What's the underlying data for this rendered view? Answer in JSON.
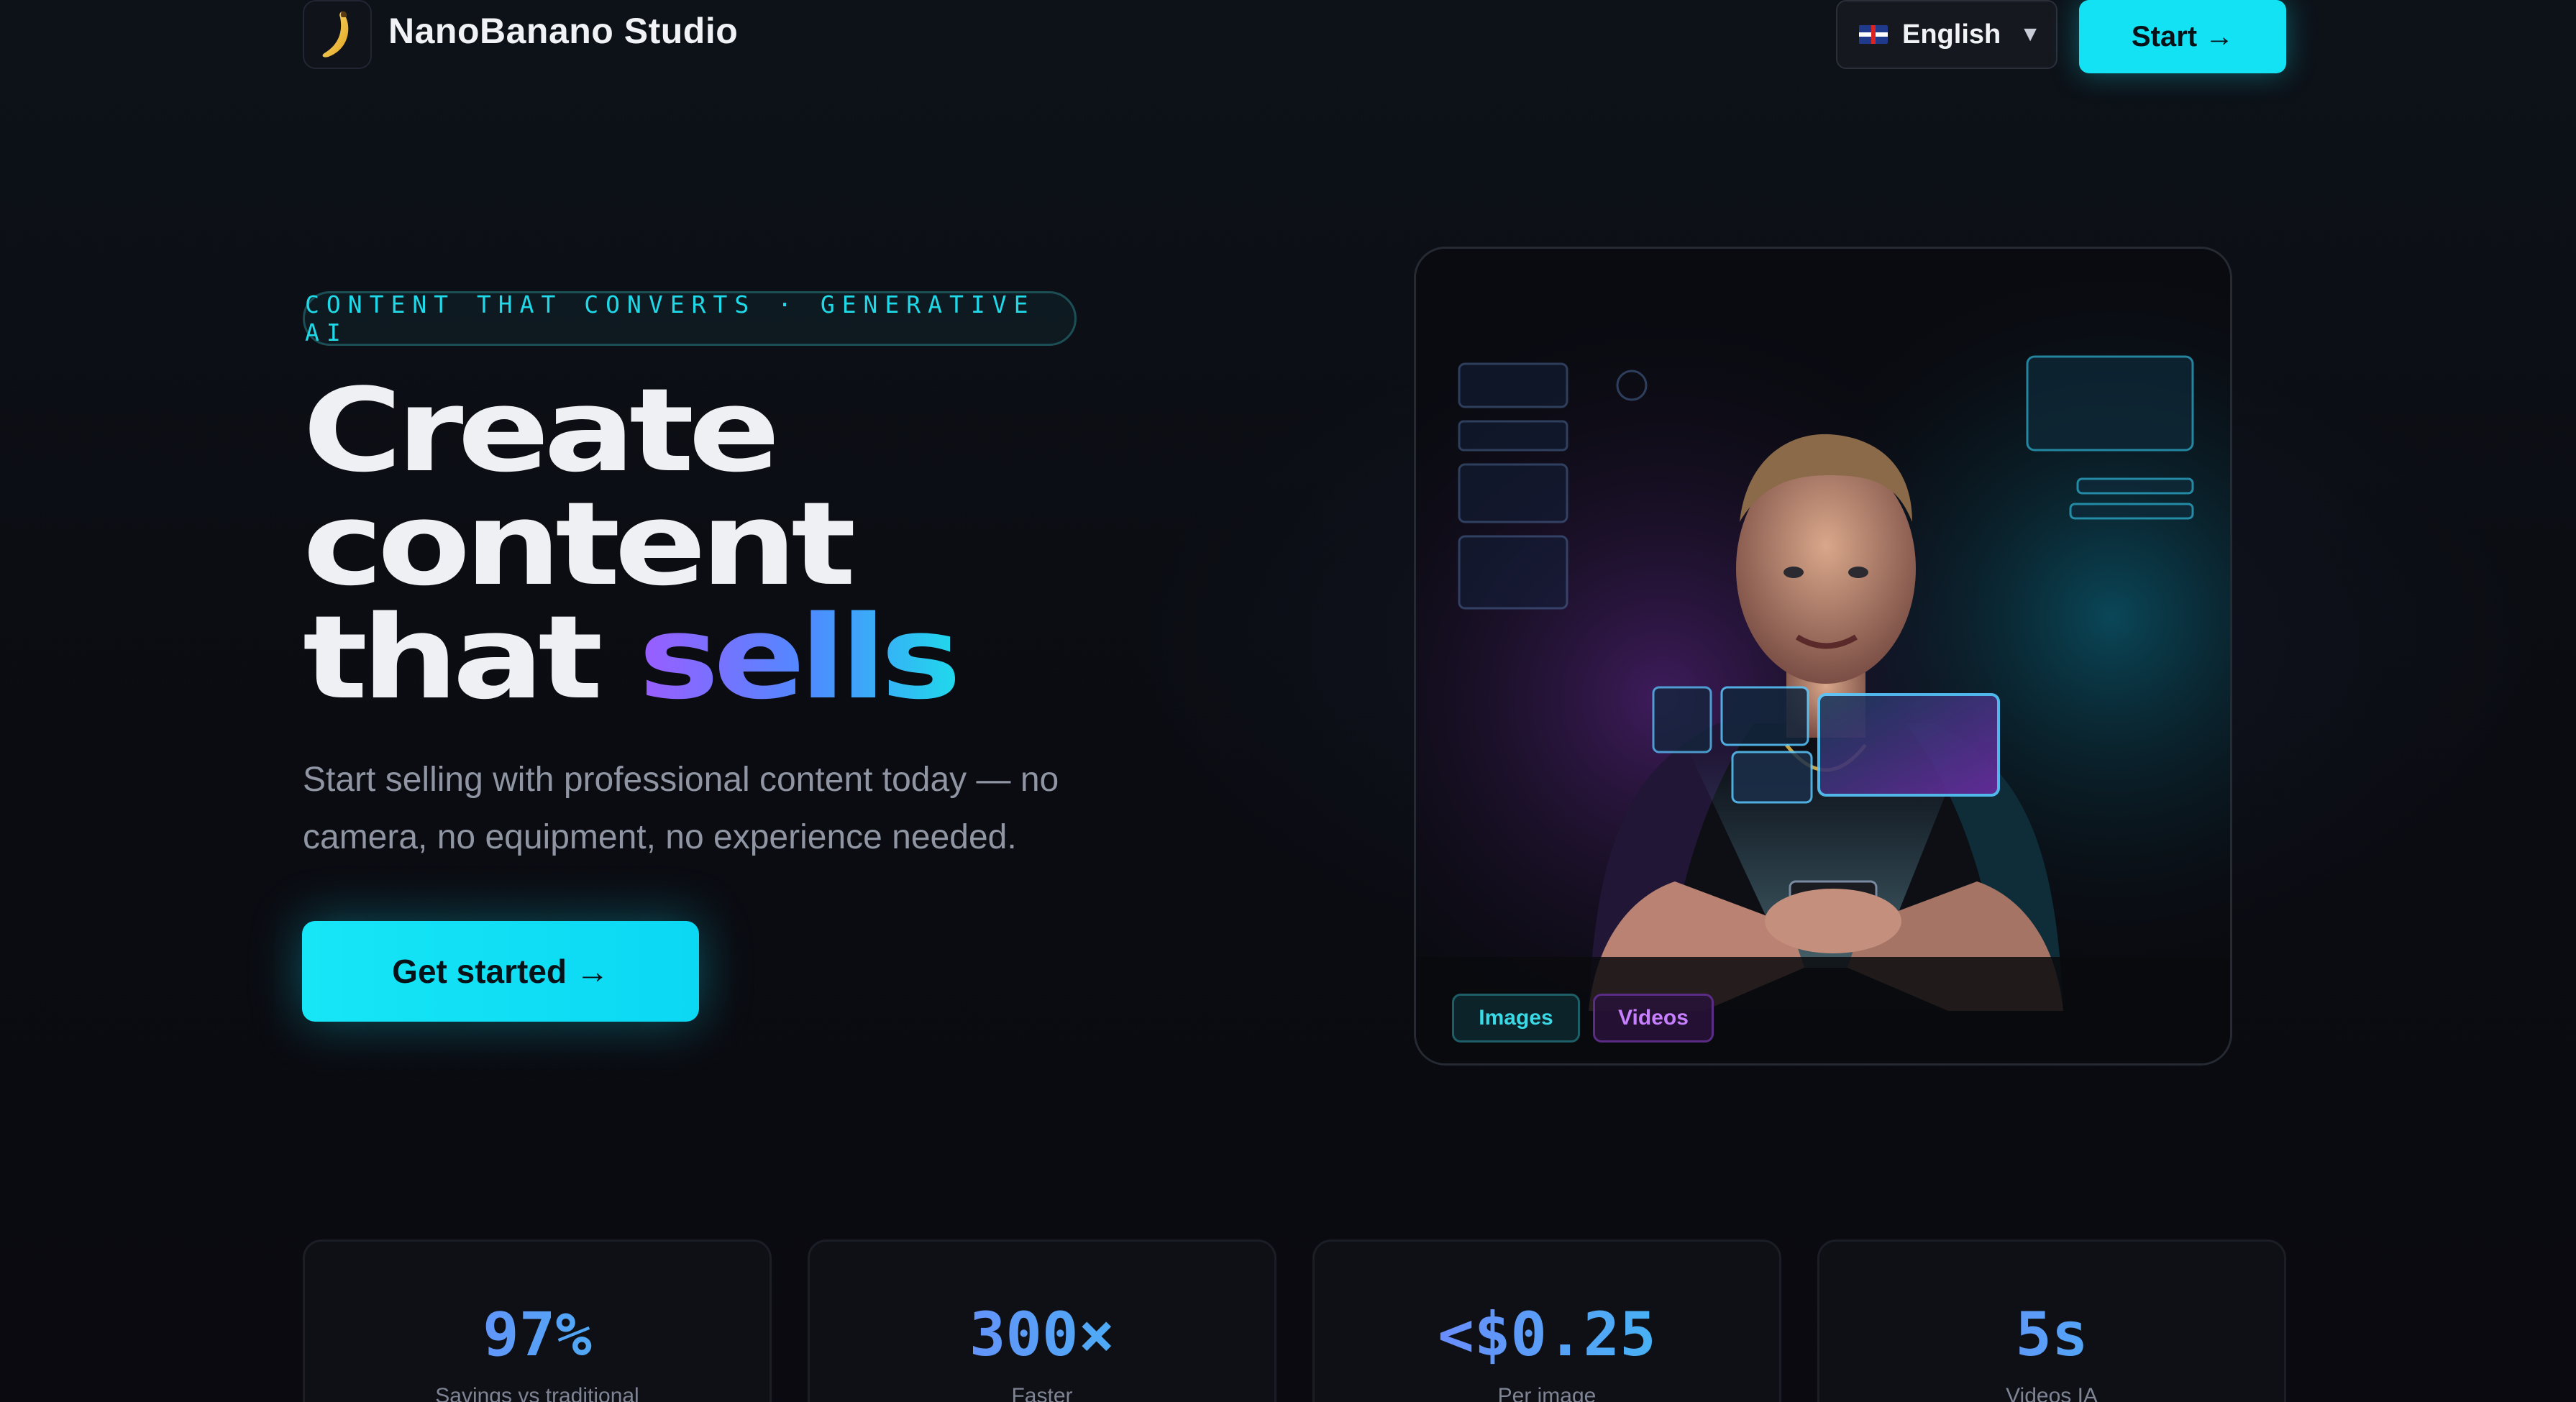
{
  "header": {
    "brand": "NanoBanano Studio",
    "logo_icon": "banana-icon",
    "language": "English",
    "start_label": "Start →"
  },
  "hero": {
    "eyebrow": "CONTENT THAT CONVERTS · GENERATIVE AI",
    "headline_line1": "Create",
    "headline_line2": "content",
    "headline_line3_plain": "that",
    "headline_line3_highlight": "sells",
    "subtitle": "Start selling with professional content today — no camera, no equipment, no experience needed.",
    "cta_label": "Get started →"
  },
  "media_card": {
    "tags": [
      "Images",
      "Videos"
    ]
  },
  "stats": [
    {
      "value": "97%",
      "label": "Savings vs traditional"
    },
    {
      "value": "300×",
      "label": "Faster"
    },
    {
      "value": "<$0.25",
      "label": "Per image"
    },
    {
      "value": "5s",
      "label": "Videos IA"
    }
  ],
  "colors": {
    "accent_cyan": "#13e2f5",
    "accent_purple": "#9b5cff",
    "background": "#0b0d13"
  }
}
